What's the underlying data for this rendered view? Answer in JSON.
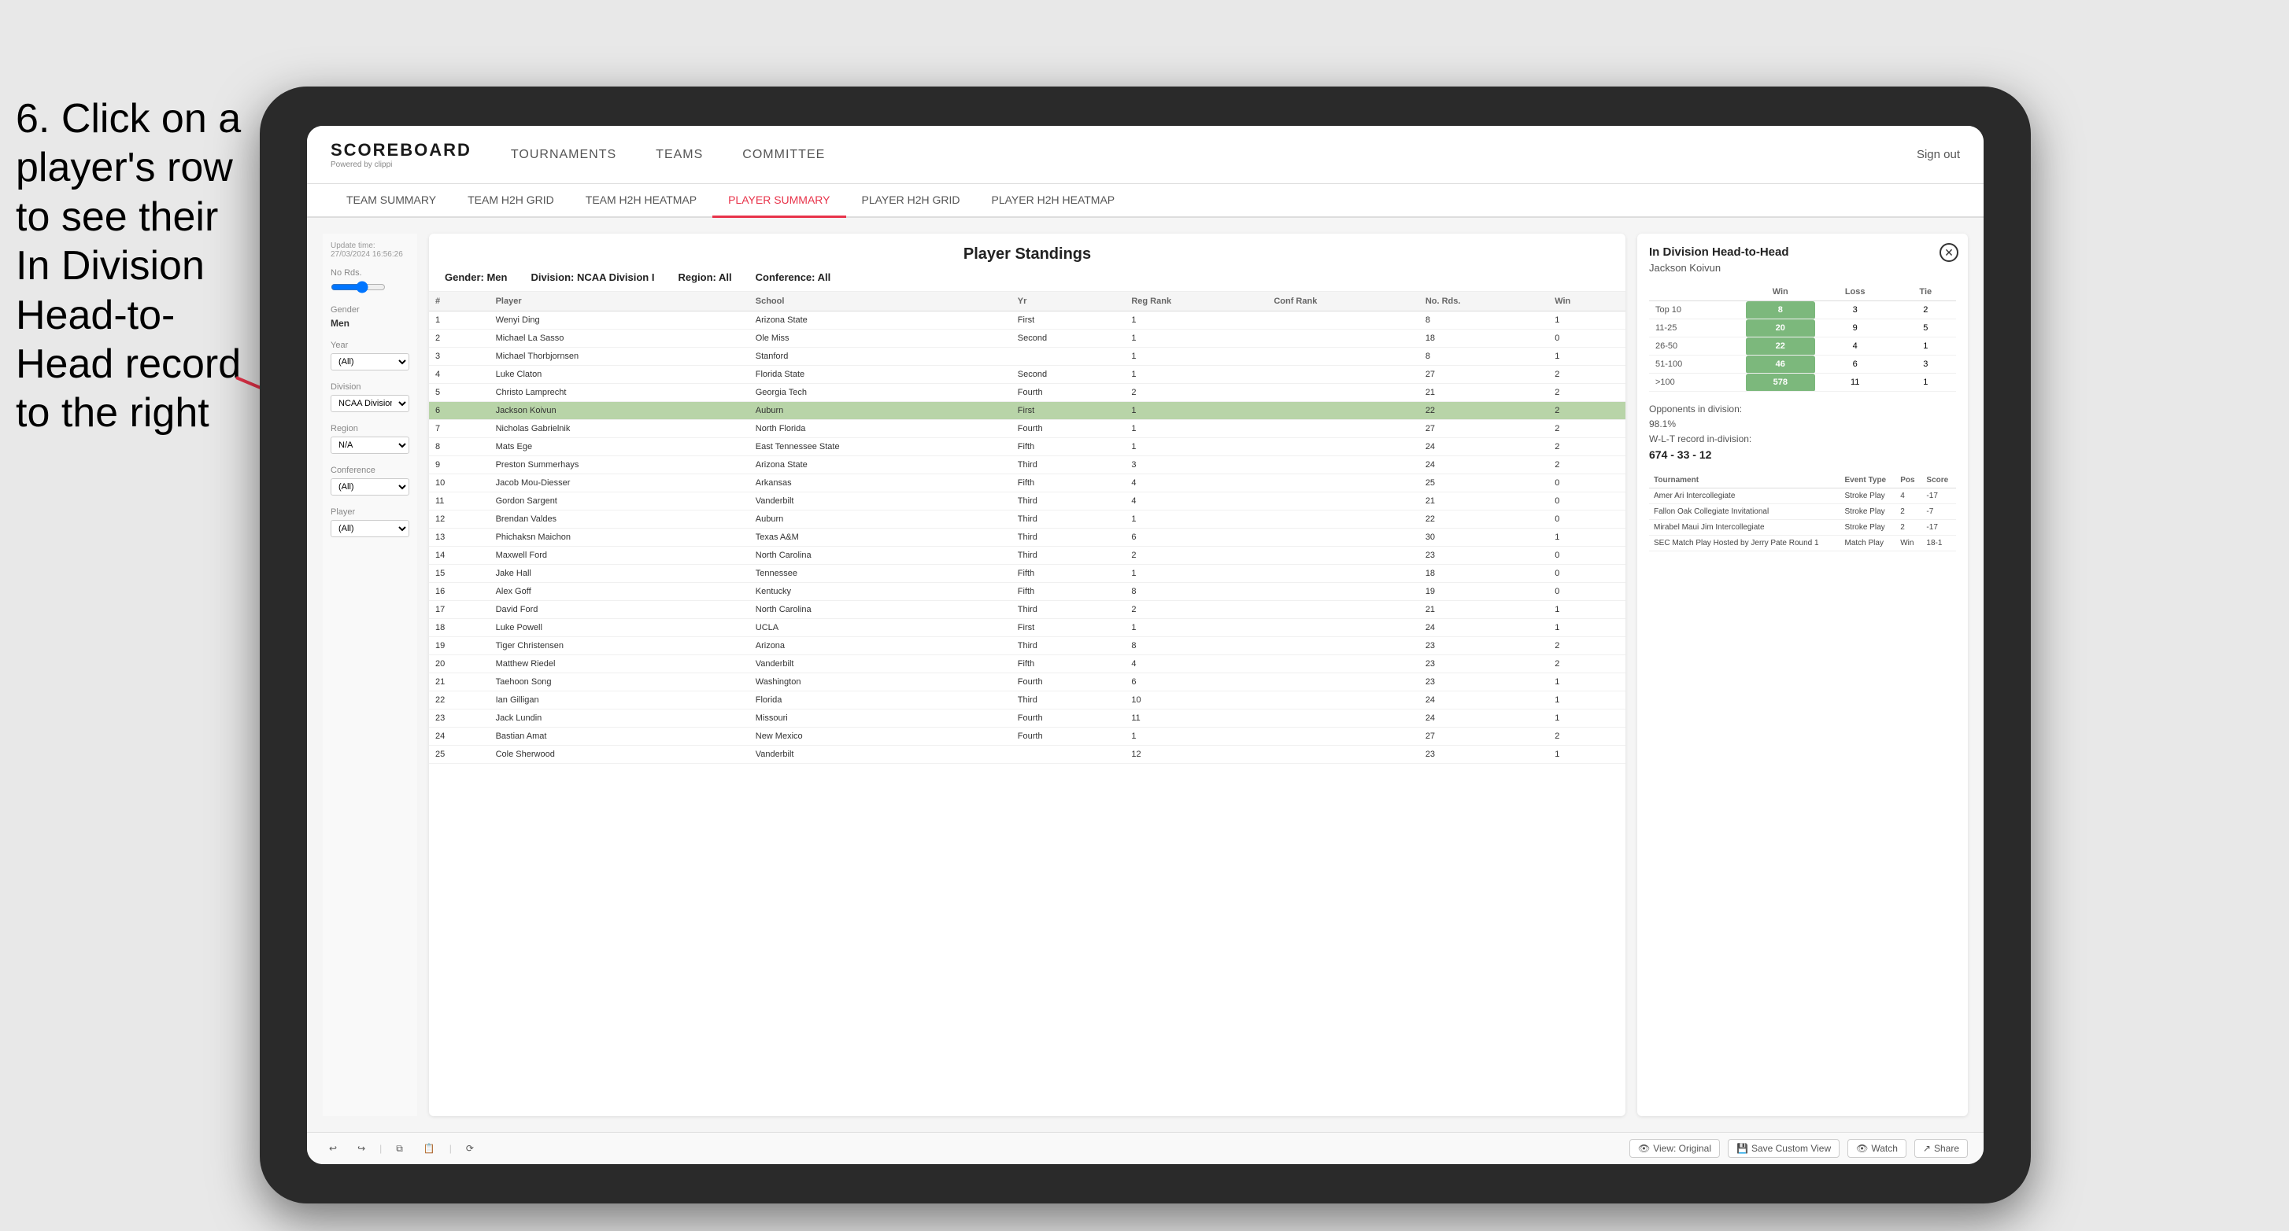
{
  "instruction": {
    "text": "6. Click on a player's row to see their In Division Head-to-Head record to the right"
  },
  "nav": {
    "logo": "SCOREBOARD",
    "powered_by": "Powered by clippi",
    "items": [
      "TOURNAMENTS",
      "TEAMS",
      "COMMITTEE"
    ],
    "sign_out": "Sign out"
  },
  "sub_nav": {
    "items": [
      "TEAM SUMMARY",
      "TEAM H2H GRID",
      "TEAM H2H HEATMAP",
      "PLAYER SUMMARY",
      "PLAYER H2H GRID",
      "PLAYER H2H HEATMAP"
    ],
    "active": "PLAYER SUMMARY"
  },
  "standings": {
    "update_time": "Update time:",
    "update_date": "27/03/2024 16:56:26",
    "title": "Player Standings",
    "gender_label": "Gender:",
    "gender": "Men",
    "division_label": "Division:",
    "division": "NCAA Division I",
    "region_label": "Region:",
    "region": "All",
    "conference_label": "Conference:",
    "conference": "All",
    "columns": [
      "#",
      "Player",
      "School",
      "Yr",
      "Reg Rank",
      "Conf Rank",
      "No. Rds.",
      "Win"
    ],
    "rows": [
      {
        "num": 1,
        "player": "Wenyi Ding",
        "school": "Arizona State",
        "yr": "First",
        "reg_rank": 1,
        "conf_rank": "",
        "no_rds": 8,
        "win": 1
      },
      {
        "num": 2,
        "player": "Michael La Sasso",
        "school": "Ole Miss",
        "yr": "Second",
        "reg_rank": 1,
        "conf_rank": "",
        "no_rds": 18,
        "win": 0
      },
      {
        "num": 3,
        "player": "Michael Thorbjornsen",
        "school": "Stanford",
        "yr": "",
        "reg_rank": 1,
        "conf_rank": "",
        "no_rds": 8,
        "win": 1
      },
      {
        "num": 4,
        "player": "Luke Claton",
        "school": "Florida State",
        "yr": "Second",
        "reg_rank": 1,
        "conf_rank": "",
        "no_rds": 27,
        "win": 2
      },
      {
        "num": 5,
        "player": "Christo Lamprecht",
        "school": "Georgia Tech",
        "yr": "Fourth",
        "reg_rank": 2,
        "conf_rank": "",
        "no_rds": 21,
        "win": 2
      },
      {
        "num": 6,
        "player": "Jackson Koivun",
        "school": "Auburn",
        "yr": "First",
        "reg_rank": 1,
        "conf_rank": "",
        "no_rds": 22,
        "win": 2
      },
      {
        "num": 7,
        "player": "Nicholas Gabrielnik",
        "school": "North Florida",
        "yr": "Fourth",
        "reg_rank": 1,
        "conf_rank": "",
        "no_rds": 27,
        "win": 2
      },
      {
        "num": 8,
        "player": "Mats Ege",
        "school": "East Tennessee State",
        "yr": "Fifth",
        "reg_rank": 1,
        "conf_rank": "",
        "no_rds": 24,
        "win": 2
      },
      {
        "num": 9,
        "player": "Preston Summerhays",
        "school": "Arizona State",
        "yr": "Third",
        "reg_rank": 3,
        "conf_rank": "",
        "no_rds": 24,
        "win": 2
      },
      {
        "num": 10,
        "player": "Jacob Mou-Diesser",
        "school": "Arkansas",
        "yr": "Fifth",
        "reg_rank": 4,
        "conf_rank": "",
        "no_rds": 25,
        "win": 0
      },
      {
        "num": 11,
        "player": "Gordon Sargent",
        "school": "Vanderbilt",
        "yr": "Third",
        "reg_rank": 4,
        "conf_rank": "",
        "no_rds": 21,
        "win": 0
      },
      {
        "num": 12,
        "player": "Brendan Valdes",
        "school": "Auburn",
        "yr": "Third",
        "reg_rank": 1,
        "conf_rank": "",
        "no_rds": 22,
        "win": 0
      },
      {
        "num": 13,
        "player": "Phichaksn Maichon",
        "school": "Texas A&M",
        "yr": "Third",
        "reg_rank": 6,
        "conf_rank": "",
        "no_rds": 30,
        "win": 1
      },
      {
        "num": 14,
        "player": "Maxwell Ford",
        "school": "North Carolina",
        "yr": "Third",
        "reg_rank": 2,
        "conf_rank": "",
        "no_rds": 23,
        "win": 0
      },
      {
        "num": 15,
        "player": "Jake Hall",
        "school": "Tennessee",
        "yr": "Fifth",
        "reg_rank": 1,
        "conf_rank": "",
        "no_rds": 18,
        "win": 0
      },
      {
        "num": 16,
        "player": "Alex Goff",
        "school": "Kentucky",
        "yr": "Fifth",
        "reg_rank": 8,
        "conf_rank": "",
        "no_rds": 19,
        "win": 0
      },
      {
        "num": 17,
        "player": "David Ford",
        "school": "North Carolina",
        "yr": "Third",
        "reg_rank": 2,
        "conf_rank": "",
        "no_rds": 21,
        "win": 1
      },
      {
        "num": 18,
        "player": "Luke Powell",
        "school": "UCLA",
        "yr": "First",
        "reg_rank": 1,
        "conf_rank": "",
        "no_rds": 24,
        "win": 1
      },
      {
        "num": 19,
        "player": "Tiger Christensen",
        "school": "Arizona",
        "yr": "Third",
        "reg_rank": 8,
        "conf_rank": "",
        "no_rds": 23,
        "win": 2
      },
      {
        "num": 20,
        "player": "Matthew Riedel",
        "school": "Vanderbilt",
        "yr": "Fifth",
        "reg_rank": 4,
        "conf_rank": "",
        "no_rds": 23,
        "win": 2
      },
      {
        "num": 21,
        "player": "Taehoon Song",
        "school": "Washington",
        "yr": "Fourth",
        "reg_rank": 6,
        "conf_rank": "",
        "no_rds": 23,
        "win": 1
      },
      {
        "num": 22,
        "player": "Ian Gilligan",
        "school": "Florida",
        "yr": "Third",
        "reg_rank": 10,
        "conf_rank": "",
        "no_rds": 24,
        "win": 1
      },
      {
        "num": 23,
        "player": "Jack Lundin",
        "school": "Missouri",
        "yr": "Fourth",
        "reg_rank": 11,
        "conf_rank": "",
        "no_rds": 24,
        "win": 1
      },
      {
        "num": 24,
        "player": "Bastian Amat",
        "school": "New Mexico",
        "yr": "Fourth",
        "reg_rank": 1,
        "conf_rank": "",
        "no_rds": 27,
        "win": 2
      },
      {
        "num": 25,
        "player": "Cole Sherwood",
        "school": "Vanderbilt",
        "yr": "",
        "reg_rank": 12,
        "conf_rank": "",
        "no_rds": 23,
        "win": 1
      }
    ]
  },
  "filters": {
    "no_rds_label": "No Rds.",
    "gender_label": "Gender",
    "gender_value": "Men",
    "year_label": "Year",
    "year_value": "(All)",
    "division_label": "Division",
    "division_value": "NCAA Division I",
    "region_label": "Region",
    "region_value": "N/A",
    "conference_label": "Conference",
    "conference_value": "(All)",
    "player_label": "Player",
    "player_value": "(All)"
  },
  "h2h": {
    "title": "In Division Head-to-Head",
    "player_name": "Jackson Koivun",
    "win_label": "Win",
    "loss_label": "Loss",
    "tie_label": "Tie",
    "rows": [
      {
        "rank": "Top 10",
        "win": 8,
        "loss": 3,
        "tie": 2
      },
      {
        "rank": "11-25",
        "win": 20,
        "loss": 9,
        "tie": 5
      },
      {
        "rank": "26-50",
        "win": 22,
        "loss": 4,
        "tie": 1
      },
      {
        "rank": "51-100",
        "win": 46,
        "loss": 6,
        "tie": 3
      },
      {
        "rank": ">100",
        "win": 578,
        "loss": 11,
        "tie": 1
      }
    ],
    "opponents_label": "Opponents in division:",
    "opponents_pct": "98.1%",
    "wlt_label": "W-L-T record in-division:",
    "wlt_record": "674 - 33 - 12",
    "tournament_columns": [
      "Tournament",
      "Event Type",
      "Pos",
      "Score"
    ],
    "tournaments": [
      {
        "name": "Amer Ari Intercollegiate",
        "type": "Stroke Play",
        "pos": 4,
        "score": "-17"
      },
      {
        "name": "Fallon Oak Collegiate Invitational",
        "type": "Stroke Play",
        "pos": 2,
        "score": "-7"
      },
      {
        "name": "Mirabel Maui Jim Intercollegiate",
        "type": "Stroke Play",
        "pos": 2,
        "score": "-17"
      },
      {
        "name": "SEC Match Play Hosted by Jerry Pate Round 1",
        "type": "Match Play",
        "pos": "Win",
        "score": "18-1"
      }
    ]
  },
  "toolbar": {
    "undo": "↩",
    "redo": "↪",
    "view_original": "View: Original",
    "save_custom": "Save Custom View",
    "watch": "Watch",
    "share": "Share"
  }
}
